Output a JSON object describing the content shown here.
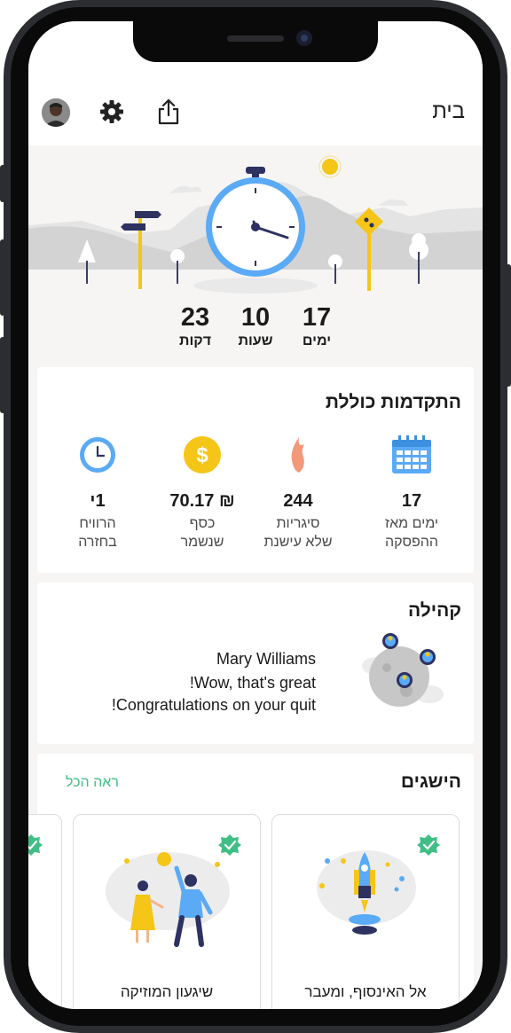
{
  "header": {
    "title": "בית",
    "icons": [
      "avatar",
      "gear-icon",
      "share-icon"
    ]
  },
  "counters": [
    {
      "value": "17",
      "label": "ימים"
    },
    {
      "value": "10",
      "label": "שעות"
    },
    {
      "value": "23",
      "label": "דקות"
    }
  ],
  "progress": {
    "title": "התקדמות כוללת",
    "stats": [
      {
        "icon": "calendar-icon",
        "value": "17",
        "label1": "ימים מאז",
        "label2": "ההפסקה"
      },
      {
        "icon": "flame-icon",
        "value": "244",
        "label1": "סיגריות",
        "label2": "שלא עישנת"
      },
      {
        "icon": "dollar-coin-icon",
        "value": "₪ 70.17",
        "label1": "כסף",
        "label2": "שנשמר"
      },
      {
        "icon": "clock-icon",
        "value": "1י",
        "label1": "הרוויח",
        "label2": "בחזרה"
      }
    ]
  },
  "community": {
    "title": "קהילה",
    "name": "Mary Williams",
    "message_line1": "Wow, that's great!",
    "message_line2": "Congratulations on your quit!"
  },
  "achievements": {
    "title": "הישגים",
    "see_all": "ראה הכל",
    "items": [
      {
        "label": "אל האינסוף, ומעבר",
        "badge": "check-badge-icon"
      },
      {
        "label": "שיגעון המוזיקה",
        "badge": "check-badge-icon"
      }
    ]
  },
  "colors": {
    "accent_green": "#3fbf85",
    "clock_blue": "#5aaaf5",
    "yellow": "#f5c518",
    "flame": "#f4987a"
  }
}
